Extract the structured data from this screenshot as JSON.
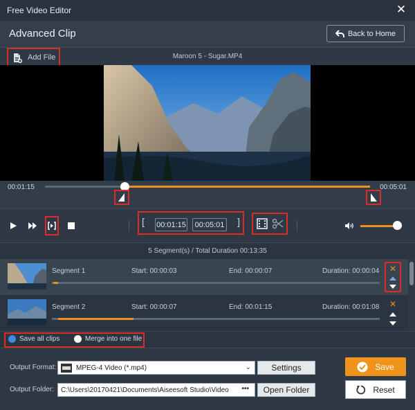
{
  "window": {
    "title": "Free Video Editor"
  },
  "header": {
    "title": "Advanced Clip",
    "back_label": "Back to Home"
  },
  "file": {
    "add_label": "Add File",
    "current_name": "Maroon 5 - Sugar.MP4"
  },
  "trim": {
    "start_time": "00:01:15",
    "end_time": "00:05:01",
    "clip_start_fraction": 0.245,
    "clip_end_fraction": 1.0
  },
  "controls": {
    "clip_start": "00:01:15",
    "clip_end": "00:05:01",
    "volume_fraction": 0.92
  },
  "segments_summary": "5 Segment(s) / Total Duration 00:13:35",
  "segments": [
    {
      "name": "Segment 1",
      "start": "Start: 00:00:03",
      "end": "End: 00:00:07",
      "duration": "Duration: 00:00:04",
      "bar_start": 0.005,
      "bar_end": 0.02,
      "selected": true
    },
    {
      "name": "Segment 2",
      "start": "Start: 00:00:07",
      "end": "End: 00:01:15",
      "duration": "Duration: 00:01:08",
      "bar_start": 0.02,
      "bar_end": 0.25,
      "selected": false
    }
  ],
  "options": {
    "save_all": "Save all clips",
    "merge": "Merge into one file",
    "selected": "save_all"
  },
  "output": {
    "format_label": "Output Format:",
    "format_value": "MPEG-4 Video (*.mp4)",
    "settings_label": "Settings",
    "folder_label": "Output Folder:",
    "folder_value": "C:\\Users\\20170421\\Documents\\Aiseesoft Studio\\Video",
    "open_folder_label": "Open Folder",
    "save_label": "Save",
    "reset_label": "Reset"
  },
  "colors": {
    "accent": "#f0901e",
    "highlight": "#e02a2a",
    "radio_selected": "#3d8be0"
  }
}
